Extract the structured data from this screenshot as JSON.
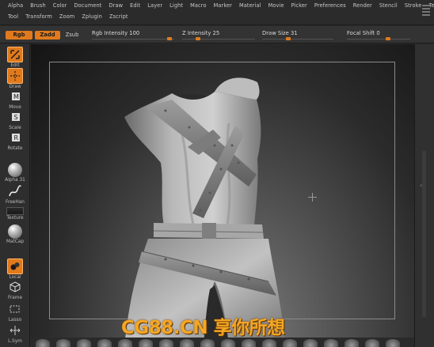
{
  "menu": {
    "row1": [
      "Alpha",
      "Brush",
      "Color",
      "Document",
      "Draw",
      "Edit",
      "Layer",
      "Light",
      "Macro",
      "Marker",
      "Material",
      "Movie",
      "Picker",
      "Preferences",
      "Render",
      "Stencil",
      "Stroke",
      "Texture"
    ],
    "row2": [
      "Tool",
      "Transform",
      "Zoom",
      "Zplugin",
      "Zscript"
    ]
  },
  "options": {
    "rgb": "Rgb",
    "zadd": "Zadd",
    "zsub": "Zsub",
    "rgb_intensity": {
      "label": "Rgb Intensity 100",
      "value": 100
    },
    "z_intensity": {
      "label": "Z Intensity 25",
      "value": 25
    },
    "draw_size": {
      "label": "Draw Size 31",
      "value": 31
    },
    "focal_shift": {
      "label": "Focal Shift 0",
      "value": 0
    }
  },
  "shelf": {
    "edit": "Edit",
    "draw": "Draw",
    "move": "Move",
    "scale": "Scale",
    "rotate": "Rotate",
    "alpha": "Alpha 31",
    "freehand": "FreeHan",
    "texture": "Texture",
    "matcap": "MatCap",
    "local": "Local",
    "frame": "Frame",
    "lasso": "Lasso",
    "lsym": "L.Sym"
  },
  "colors": {
    "accent": "#e07a1d",
    "watermark": "#f5a623"
  },
  "watermark": "CG88.CN 享你所想"
}
